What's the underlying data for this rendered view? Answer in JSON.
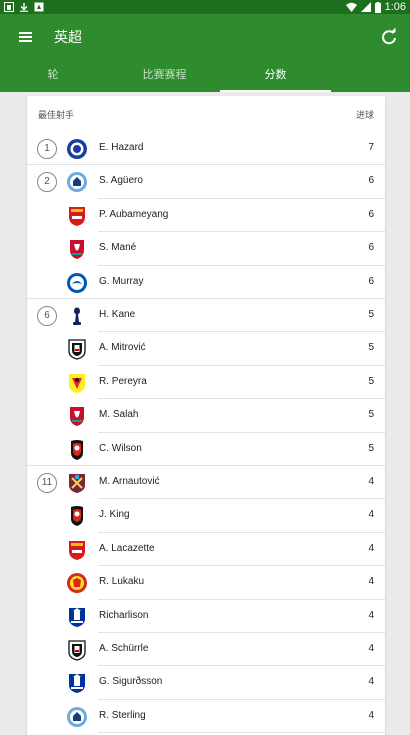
{
  "status_bar": {
    "time": "1:06"
  },
  "app_bar": {
    "title": "英超"
  },
  "tabs": [
    {
      "label": "轮",
      "active": false
    },
    {
      "label": "比赛赛程",
      "active": false
    },
    {
      "label": "分数",
      "active": true
    }
  ],
  "scorers": {
    "header_left": "最佳射手",
    "header_right": "进球",
    "rows": [
      {
        "rank": "1",
        "name": "E. Hazard",
        "goals": "7",
        "club_icon": "chelsea-crest-icon"
      },
      {
        "rank": "2",
        "name": "S. Agüero",
        "goals": "6",
        "club_icon": "man-city-crest-icon"
      },
      {
        "rank": "",
        "name": "P. Aubameyang",
        "goals": "6",
        "club_icon": "arsenal-crest-icon"
      },
      {
        "rank": "",
        "name": "S. Mané",
        "goals": "6",
        "club_icon": "liverpool-crest-icon"
      },
      {
        "rank": "",
        "name": "G. Murray",
        "goals": "6",
        "club_icon": "brighton-crest-icon"
      },
      {
        "rank": "6",
        "name": "H. Kane",
        "goals": "5",
        "club_icon": "tottenham-crest-icon"
      },
      {
        "rank": "",
        "name": "A. Mitrović",
        "goals": "5",
        "club_icon": "fulham-crest-icon"
      },
      {
        "rank": "",
        "name": "R. Pereyra",
        "goals": "5",
        "club_icon": "watford-crest-icon"
      },
      {
        "rank": "",
        "name": "M. Salah",
        "goals": "5",
        "club_icon": "liverpool-crest-icon"
      },
      {
        "rank": "",
        "name": "C. Wilson",
        "goals": "5",
        "club_icon": "bournemouth-crest-icon"
      },
      {
        "rank": "11",
        "name": "M. Arnautović",
        "goals": "4",
        "club_icon": "west-ham-crest-icon"
      },
      {
        "rank": "",
        "name": "J. King",
        "goals": "4",
        "club_icon": "bournemouth-crest-icon"
      },
      {
        "rank": "",
        "name": "A. Lacazette",
        "goals": "4",
        "club_icon": "arsenal-crest-icon"
      },
      {
        "rank": "",
        "name": "R. Lukaku",
        "goals": "4",
        "club_icon": "man-united-crest-icon"
      },
      {
        "rank": "",
        "name": "Richarlison",
        "goals": "4",
        "club_icon": "everton-crest-icon"
      },
      {
        "rank": "",
        "name": "A. Schürrle",
        "goals": "4",
        "club_icon": "fulham-crest-icon"
      },
      {
        "rank": "",
        "name": "G. Sigurðsson",
        "goals": "4",
        "club_icon": "everton-crest-icon"
      },
      {
        "rank": "",
        "name": "R. Sterling",
        "goals": "4",
        "club_icon": "man-city-crest-icon"
      }
    ]
  },
  "colors": {
    "app_bar": "#2e8b2e",
    "status_bar": "#1d6e1d"
  }
}
